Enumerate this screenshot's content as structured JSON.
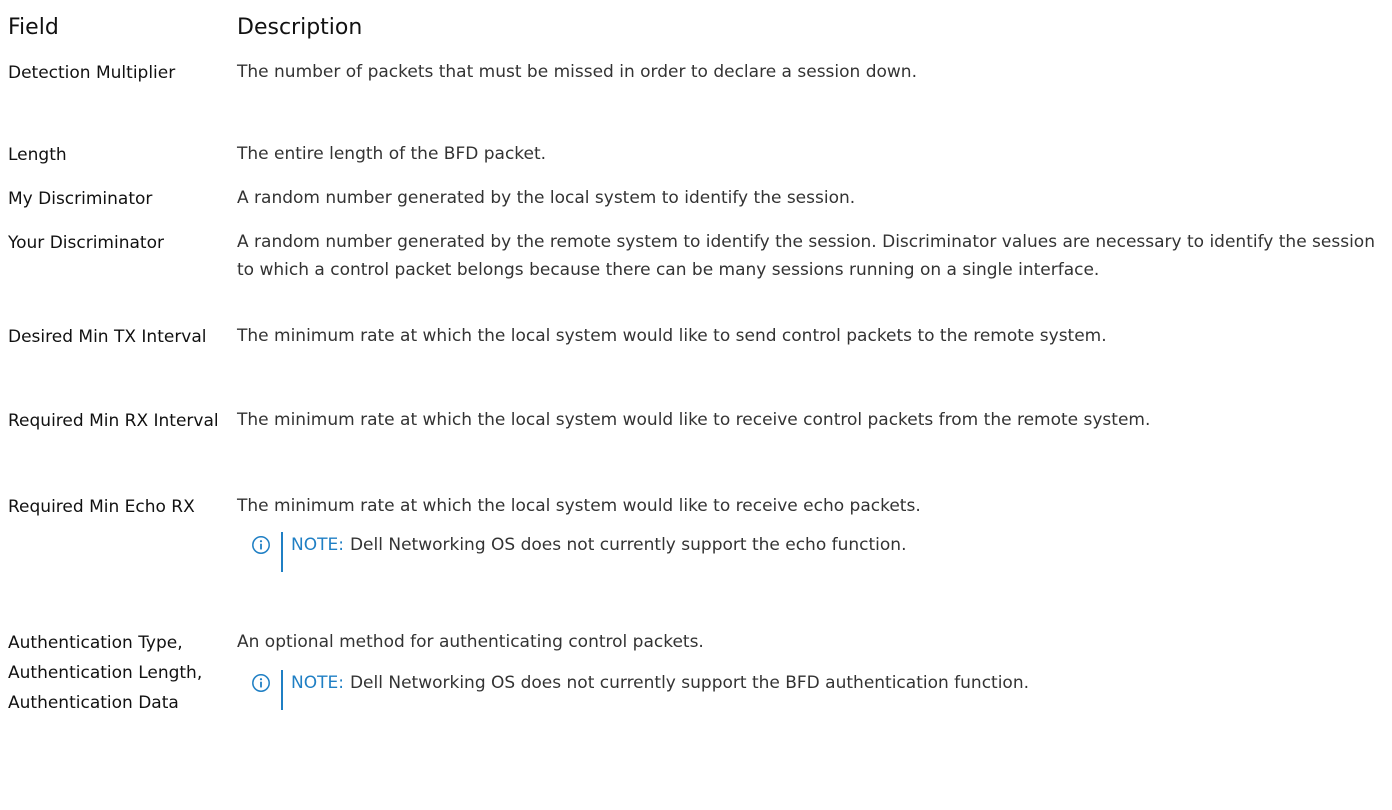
{
  "header": {
    "field": "Field",
    "description": "Description"
  },
  "rows": [
    {
      "field": "Detection Multiplier",
      "description": "The number of packets that must be missed in order to declare a session down."
    },
    {
      "field": "Length",
      "description": "The entire length of the BFD packet."
    },
    {
      "field": "My Discriminator",
      "description": "A random number generated by the local system to identify the session."
    },
    {
      "field": "Your Discriminator",
      "description": "A random number generated by the remote system to identify the session. Discriminator values are necessary to identify the session to which a control packet belongs because there can be many sessions running on a single interface."
    },
    {
      "field": "Desired Min TX Interval",
      "description": "The minimum rate at which the local system would like to send control packets to the remote system."
    },
    {
      "field": "Required Min RX Interval",
      "description": "The minimum rate at which the local system would like to receive control packets from the remote system."
    },
    {
      "field": "Required Min Echo RX",
      "description": "The minimum rate at which the local system would like to receive echo packets.",
      "note_label": "NOTE:",
      "note_text": "Dell Networking OS does not currently support the echo function."
    },
    {
      "field": "Authentication Type, Authentication Length, Authentication Data",
      "description": "An optional method for authenticating control packets.",
      "note_label": "NOTE:",
      "note_text": "Dell Networking OS does not currently support the BFD authentication function."
    }
  ],
  "icons": {
    "note": "info-icon"
  },
  "colors": {
    "note_accent": "#1f7fc4"
  }
}
